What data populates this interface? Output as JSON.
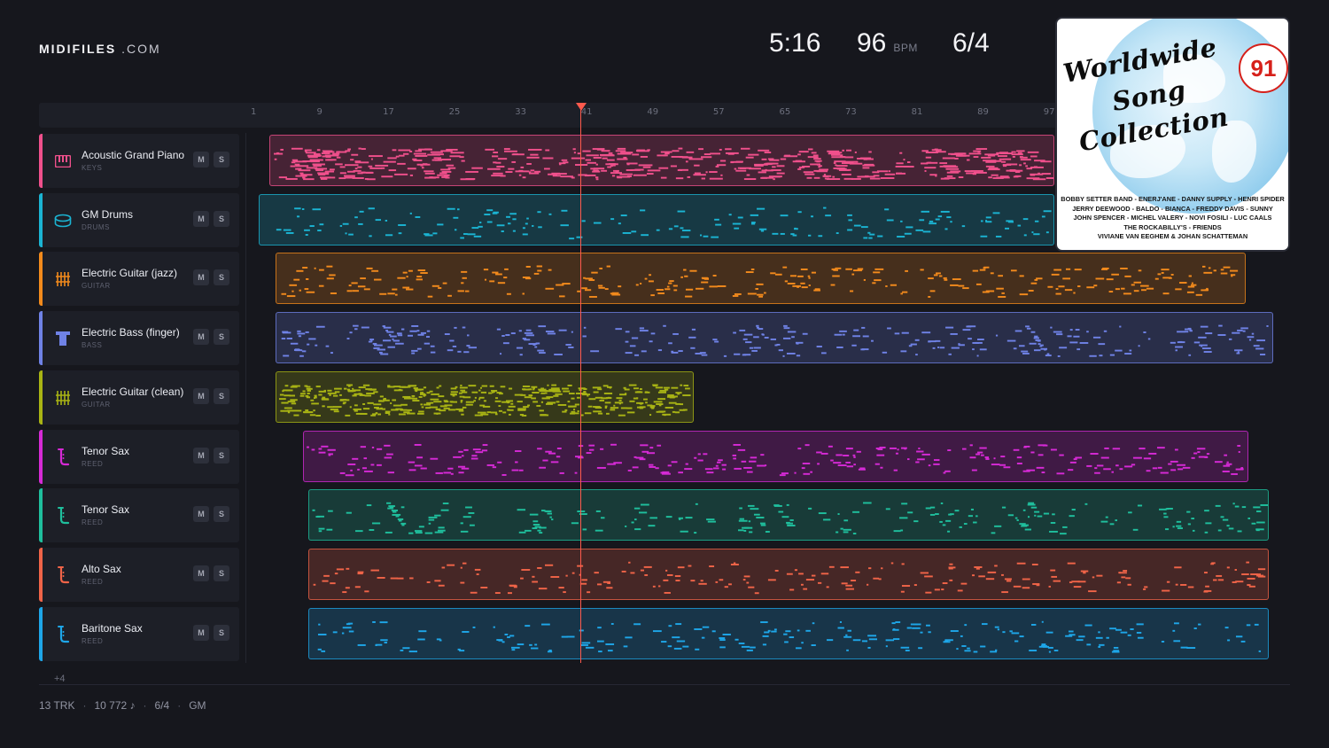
{
  "brand": {
    "name": "MIDIFILES",
    "suffix": ".COM"
  },
  "transport": {
    "time": "5:16",
    "tempo": "96",
    "tempo_unit": "BPM",
    "meter": "6/4"
  },
  "ruler": {
    "bars": [
      "1",
      "9",
      "17",
      "25",
      "33",
      "41",
      "49",
      "57",
      "65",
      "73",
      "81",
      "89",
      "97"
    ]
  },
  "tracks": [
    {
      "name": "Acoustic Grand Piano",
      "category": "KEYS",
      "color": "#f0508c",
      "icon": "piano-icon",
      "mute": "M",
      "solo": "S"
    },
    {
      "name": "GM Drums",
      "category": "DRUMS",
      "color": "#1bb4d3",
      "icon": "drum-icon",
      "mute": "M",
      "solo": "S"
    },
    {
      "name": "Electric Guitar (jazz)",
      "category": "GUITAR",
      "color": "#f28a1c",
      "icon": "guitar-fretboard-icon",
      "mute": "M",
      "solo": "S"
    },
    {
      "name": "Electric Bass (finger)",
      "category": "BASS",
      "color": "#6f82e6",
      "icon": "bass-icon",
      "mute": "M",
      "solo": "S"
    },
    {
      "name": "Electric Guitar (clean)",
      "category": "GUITAR",
      "color": "#a9b414",
      "icon": "guitar-fretboard-icon",
      "mute": "M",
      "solo": "S"
    },
    {
      "name": "Tenor Sax",
      "category": "REED",
      "color": "#d62ad6",
      "icon": "saxophone-icon",
      "mute": "M",
      "solo": "S"
    },
    {
      "name": "Tenor Sax",
      "category": "REED",
      "color": "#1fbf9d",
      "icon": "saxophone-icon",
      "mute": "M",
      "solo": "S"
    },
    {
      "name": "Alto Sax",
      "category": "REED",
      "color": "#f06448",
      "icon": "saxophone-icon",
      "mute": "M",
      "solo": "S"
    },
    {
      "name": "Baritone Sax",
      "category": "REED",
      "color": "#1ea6e8",
      "icon": "saxophone-icon",
      "mute": "M",
      "solo": "S"
    }
  ],
  "more_tracks": "+4",
  "footer": {
    "tracks": "13 TRK",
    "notes": "10 772 ♪",
    "meter": "6/4",
    "standard": "GM"
  },
  "cover": {
    "line1": "Worldwide",
    "line2": "Song",
    "line3": "Collection",
    "number": "91",
    "artists": [
      "BOBBY SETTER BAND - ENERJ'ANE - DANNY SUPPLY - HENRI SPIDER",
      "JERRY DEEWOOD - BALDO - BIANCA - FREDDY DAVIS - SUNNY",
      "JOHN SPENCER - MICHEL VALERY - NOVI FOSILI - LUC CAALS",
      "THE ROCKABILLY'S -  FRIENDS",
      "VIVIANE VAN EEGHEM & JOHAN SCHATTEMAN"
    ]
  }
}
